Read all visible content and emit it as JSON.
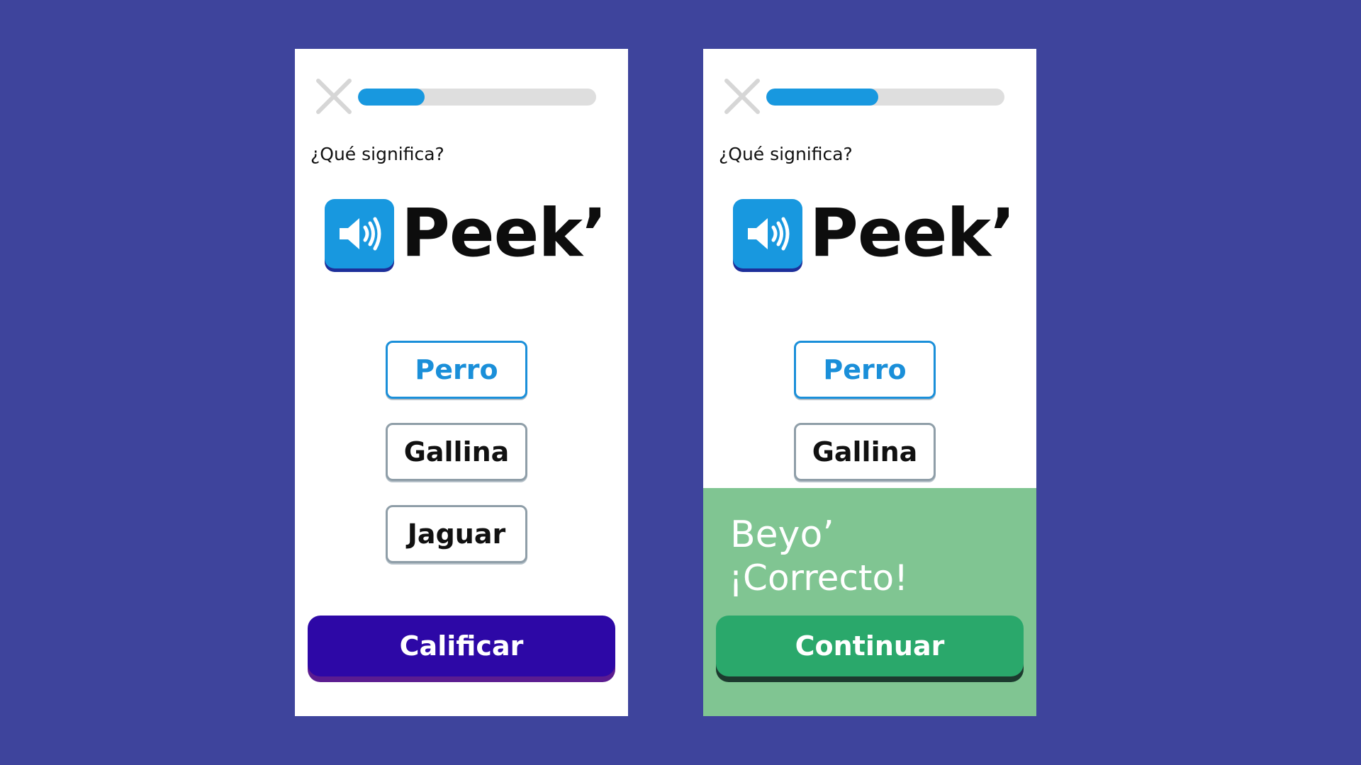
{
  "colors": {
    "background": "#3e449c",
    "accent_blue": "#1898df",
    "grade_button": "#2d08a6",
    "continue_button": "#2aa86b",
    "feedback_panel": "#80c592"
  },
  "screens": [
    {
      "progress": 0.28,
      "prompt": "¿Qué significa?",
      "word": "Peek’",
      "options": [
        {
          "label": "Perro",
          "selected": true
        },
        {
          "label": "Gallina",
          "selected": false
        },
        {
          "label": "Jaguar",
          "selected": false
        }
      ],
      "action_label": "Calificar"
    },
    {
      "progress": 0.47,
      "prompt": "¿Qué significa?",
      "word": "Peek’",
      "options": [
        {
          "label": "Perro",
          "selected": true
        },
        {
          "label": "Gallina",
          "selected": false
        }
      ],
      "feedback": {
        "word": "Beyo’",
        "status": "¡Correcto!"
      },
      "action_label": "Continuar"
    }
  ],
  "icons": {
    "close": "close-icon",
    "audio": "speaker-icon"
  }
}
